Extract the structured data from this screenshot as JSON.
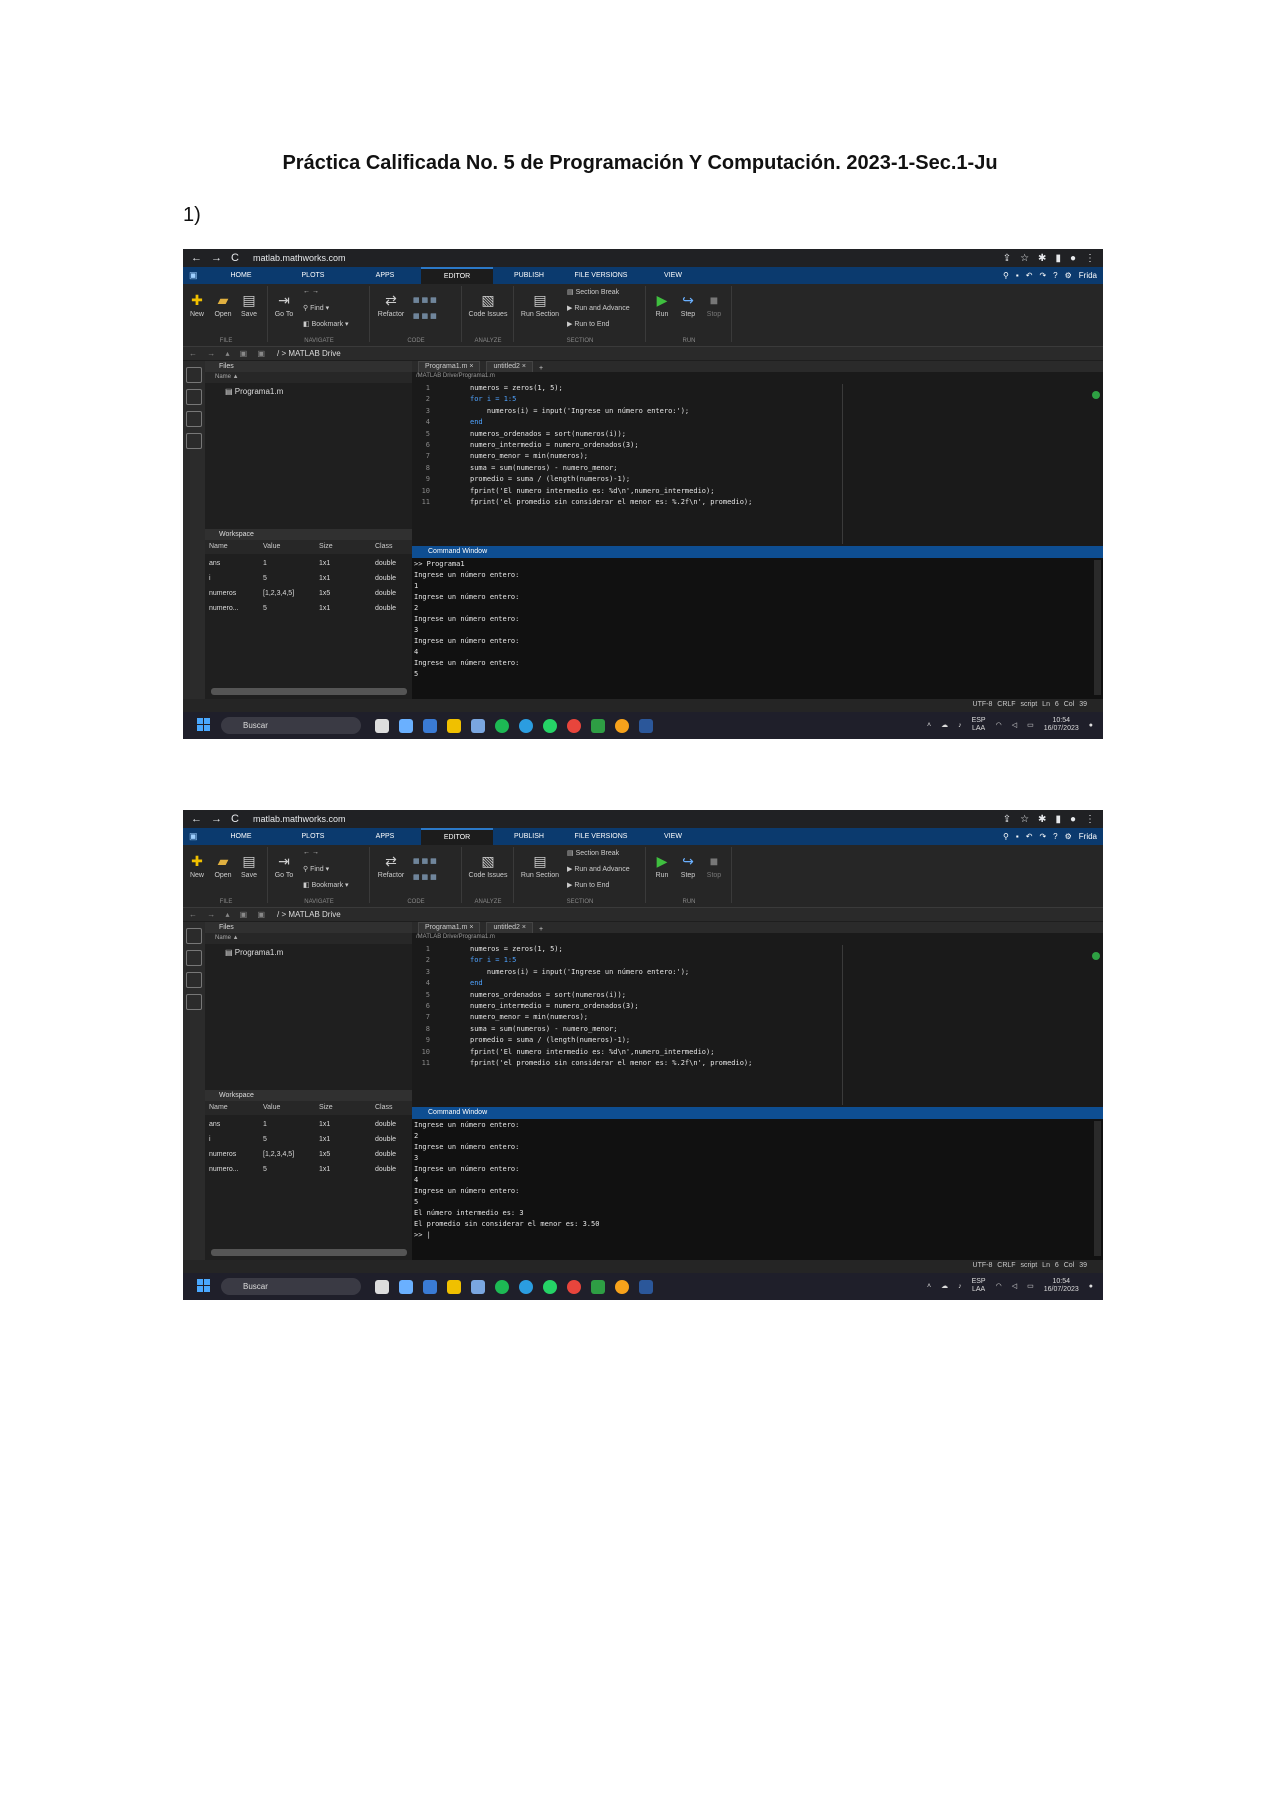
{
  "document": {
    "title": "Práctica Calificada No. 5 de Programación Y Computación. 2023-1-Sec.1-Ju",
    "question_number": "1)"
  },
  "screenshots": [
    {
      "browser": {
        "url": "matlab.mathworks.com"
      },
      "tabs": [
        "HOME",
        "PLOTS",
        "APPS",
        "EDITOR",
        "PUBLISH",
        "FILE VERSIONS",
        "VIEW"
      ],
      "active_tab": "EDITOR",
      "user": "Frida",
      "toolstrip": {
        "file_buttons": [
          "New",
          "Open",
          "Save"
        ],
        "go_to": "Go To",
        "find": "Find",
        "bookmark": "Bookmark",
        "refactor": "Refactor",
        "code_issues": "Code Issues",
        "run_section": "Run Section",
        "section_break": "Section Break",
        "run_and_advance": "Run and Advance",
        "run_to_end": "Run to End",
        "run": "Run",
        "step": "Step",
        "stop": "Stop",
        "group_labels": [
          "FILE",
          "NAVIGATE",
          "CODE",
          "ANALYZE",
          "SECTION",
          "RUN"
        ]
      },
      "address": "/ > MATLAB Drive",
      "files_panel": {
        "title": "Files",
        "column": "Name ▲",
        "items": [
          "Programa1.m"
        ]
      },
      "workspace": {
        "title": "Workspace",
        "columns": [
          "Name",
          "Value",
          "Size",
          "Class"
        ],
        "rows": [
          [
            "ans",
            "1",
            "1x1",
            "double"
          ],
          [
            "i",
            "5",
            "1x1",
            "double"
          ],
          [
            "numeros",
            "[1,2,3,4,5]",
            "1x5",
            "double"
          ],
          [
            "numero...",
            "5",
            "1x1",
            "double"
          ]
        ]
      },
      "editor": {
        "tabs": [
          "Programa1.m ×",
          "untitled2 ×",
          "+"
        ],
        "path": "/MATLAB Drive/Programa1.m",
        "code": [
          "numeros = zeros(1, 5);",
          "for i = 1:5",
          "    numeros(i) = input('Ingrese un número entero:');",
          "end",
          "numeros_ordenados = sort(numeros(i));",
          "numero_intermedio = numero_ordenados(3);",
          "numero_menor = min(numeros);",
          "suma = sum(numeros) - numero_menor;",
          "promedio = suma / (length(numeros)-1);",
          "fprint('El numero intermedio es: %d\\n',numero_intermedio);",
          "fprint('el promedio sin considerar el menor es: %.2f\\n', promedio);"
        ]
      },
      "command_window": {
        "title": "Command Window",
        "lines": [
          ">> Programa1",
          "Ingrese un número entero:",
          "1",
          "Ingrese un número entero:",
          "2",
          "Ingrese un número entero:",
          "3",
          "Ingrese un número entero:",
          "4",
          "Ingrese un número entero:",
          "5"
        ]
      },
      "status": "UTF-8  CRLF  script  Ln 6  Col 39",
      "taskbar": {
        "search": "Buscar",
        "lang_top": "ESP",
        "lang_bottom": "LAA",
        "time": "10:54",
        "date": "16/07/2023"
      }
    },
    {
      "browser": {
        "url": "matlab.mathworks.com"
      },
      "tabs": [
        "HOME",
        "PLOTS",
        "APPS",
        "EDITOR",
        "PUBLISH",
        "FILE VERSIONS",
        "VIEW"
      ],
      "active_tab": "EDITOR",
      "user": "Frida",
      "toolstrip": {
        "file_buttons": [
          "New",
          "Open",
          "Save"
        ],
        "go_to": "Go To",
        "find": "Find",
        "bookmark": "Bookmark",
        "refactor": "Refactor",
        "code_issues": "Code Issues",
        "run_section": "Run Section",
        "section_break": "Section Break",
        "run_and_advance": "Run and Advance",
        "run_to_end": "Run to End",
        "run": "Run",
        "step": "Step",
        "stop": "Stop",
        "group_labels": [
          "FILE",
          "NAVIGATE",
          "CODE",
          "ANALYZE",
          "SECTION",
          "RUN"
        ]
      },
      "address": "/ > MATLAB Drive",
      "files_panel": {
        "title": "Files",
        "column": "Name ▲",
        "items": [
          "Programa1.m"
        ]
      },
      "workspace": {
        "title": "Workspace",
        "columns": [
          "Name",
          "Value",
          "Size",
          "Class"
        ],
        "rows": [
          [
            "ans",
            "1",
            "1x1",
            "double"
          ],
          [
            "i",
            "5",
            "1x1",
            "double"
          ],
          [
            "numeros",
            "[1,2,3,4,5]",
            "1x5",
            "double"
          ],
          [
            "numero...",
            "5",
            "1x1",
            "double"
          ]
        ]
      },
      "editor": {
        "tabs": [
          "Programa1.m ×",
          "untitled2 ×",
          "+"
        ],
        "path": "/MATLAB Drive/Programa1.m",
        "code": [
          "numeros = zeros(1, 5);",
          "for i = 1:5",
          "    numeros(i) = input('Ingrese un número entero:');",
          "end",
          "numeros_ordenados = sort(numeros(i));",
          "numero_intermedio = numero_ordenados(3);",
          "numero_menor = min(numeros);",
          "suma = sum(numeros) - numero_menor;",
          "promedio = suma / (length(numeros)-1);",
          "fprint('El numero intermedio es: %d\\n',numero_intermedio);",
          "fprint('el promedio sin considerar el menor es: %.2f\\n', promedio);"
        ]
      },
      "command_window": {
        "title": "Command Window",
        "lines": [
          "Ingrese un número entero:",
          "2",
          "Ingrese un número entero:",
          "3",
          "Ingrese un número entero:",
          "4",
          "Ingrese un número entero:",
          "5",
          "El número intermedio es: 3",
          "El promedio sin considerar el menor es: 3.50",
          ">> |"
        ]
      },
      "status": "UTF-8  CRLF  script  Ln 6  Col 39",
      "taskbar": {
        "search": "Buscar",
        "lang_top": "ESP",
        "lang_bottom": "LAA",
        "time": "10:54",
        "date": "16/07/2023"
      }
    }
  ]
}
